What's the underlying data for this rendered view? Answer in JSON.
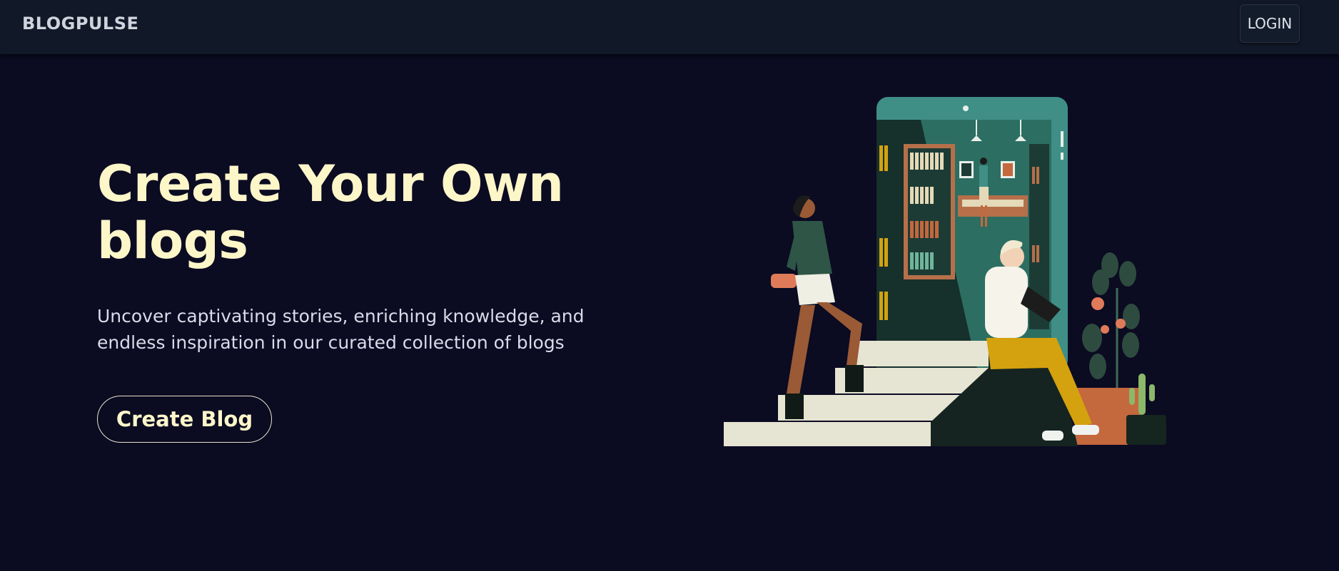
{
  "nav": {
    "brand": "BLOGPULSE",
    "login_label": "LOGIN"
  },
  "hero": {
    "title": "Create Your Own blogs",
    "subtitle": "Uncover captivating stories, enriching knowledge, and endless inspiration in our curated collection of blogs",
    "cta_label": "Create Blog",
    "illustration": "hero-illustration-reading-on-phone-steps"
  },
  "colors": {
    "background": "#0b0b22",
    "navbar": "#111827",
    "title": "#fdf6c9",
    "subtitle": "#d9dbe8",
    "phone_teal": "#3f8f87",
    "mustard": "#d4a20e",
    "terracotta": "#c4683d"
  }
}
